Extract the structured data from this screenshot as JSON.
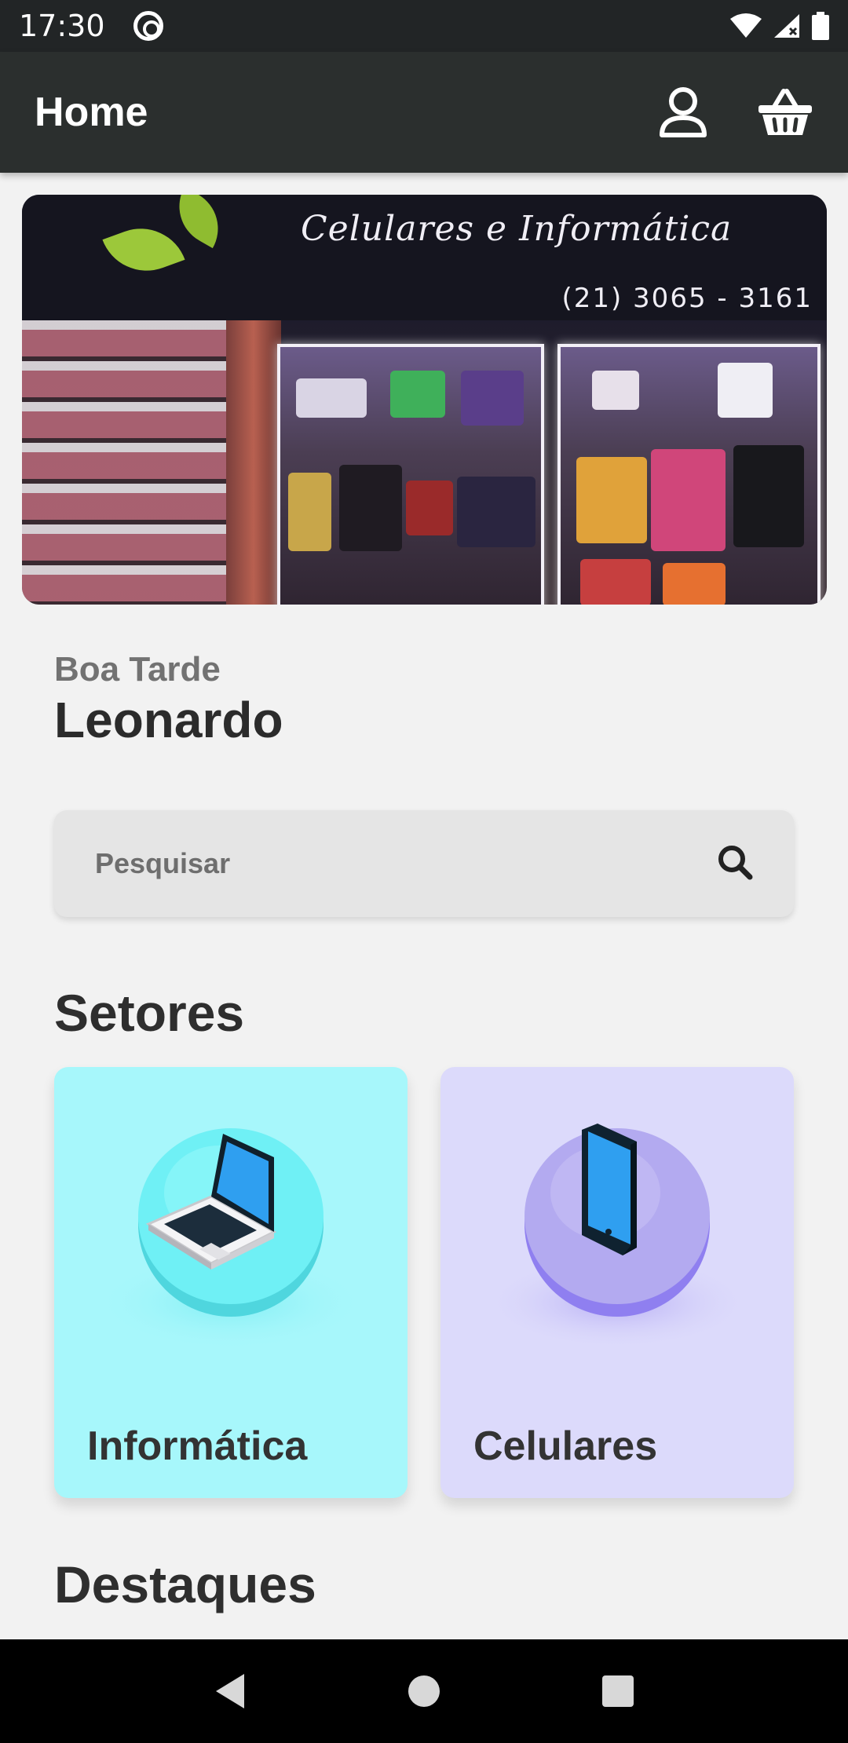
{
  "status_bar": {
    "time": "17:30",
    "icons": [
      "at-icon",
      "wifi-icon",
      "signal-icon",
      "battery-icon"
    ]
  },
  "app_bar": {
    "title": "Home",
    "actions": [
      "profile-icon",
      "basket-icon"
    ]
  },
  "banner": {
    "sign_text": "Celulares e Informática",
    "phone": "(21) 3065 - 3161"
  },
  "greeting": {
    "salutation": "Boa Tarde",
    "name": "Leonardo"
  },
  "search": {
    "placeholder": "Pesquisar",
    "icon": "search-icon"
  },
  "sections": {
    "setores": "Setores",
    "destaques": "Destaques"
  },
  "categories": [
    {
      "label": "Informática",
      "icon": "laptop-icon",
      "background": "#a7f7fb",
      "disc": "#5fe6ee"
    },
    {
      "label": "Celulares",
      "icon": "phone-icon",
      "background": "#dcdafb",
      "disc": "#a79df2"
    }
  ],
  "nav_bar": [
    "back-icon",
    "home-icon",
    "recents-icon"
  ],
  "colors": {
    "app_bar": "#2b2f2e",
    "status_bar": "#222526",
    "page_background": "#f2f2f2"
  }
}
